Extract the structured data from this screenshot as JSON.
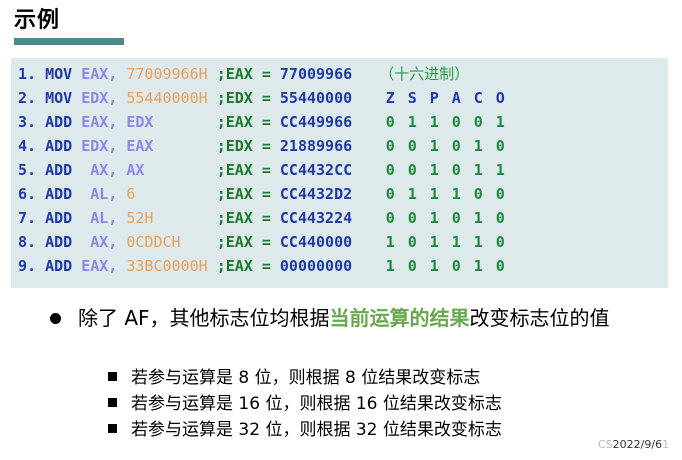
{
  "title": "示例",
  "code_lines": [
    {
      "num": "1.",
      "op": "MOV",
      "a1": "EAX,",
      "a2": "77009966H",
      "cmt": ";EAX = 77009966",
      "extra": "（十六进制）"
    },
    {
      "num": "2.",
      "op": "MOV",
      "a1": "EDX,",
      "a2": "55440000H",
      "cmt": ";EDX = 55440000",
      "flags": [
        "Z",
        "S",
        "P",
        "A",
        "C",
        "O"
      ]
    },
    {
      "num": "3.",
      "op": "ADD",
      "a1": "EAX,",
      "a2": "EDX",
      "cmt": ";EAX = CC449966",
      "flags": [
        "0",
        "1",
        "1",
        "0",
        "0",
        "1"
      ]
    },
    {
      "num": "4.",
      "op": "ADD",
      "a1": "EDX,",
      "a2": "EAX",
      "cmt": ";EDX = 21889966",
      "flags": [
        "0",
        "0",
        "1",
        "0",
        "1",
        "0"
      ]
    },
    {
      "num": "5.",
      "op": "ADD",
      "a1": "AX,",
      "a2": "AX",
      "cmt": ";EAX = CC4432CC",
      "flags": [
        "0",
        "0",
        "1",
        "0",
        "1",
        "1"
      ]
    },
    {
      "num": "6.",
      "op": "ADD",
      "a1": "AL,",
      "a2": "6",
      "cmt": ";EAX = CC4432D2",
      "flags": [
        "0",
        "1",
        "1",
        "1",
        "0",
        "0"
      ]
    },
    {
      "num": "7.",
      "op": "ADD",
      "a1": "AL,",
      "a2": "52H",
      "cmt": ";EAX = CC443224",
      "flags": [
        "0",
        "0",
        "1",
        "0",
        "1",
        "0"
      ]
    },
    {
      "num": "8.",
      "op": "ADD",
      "a1": "AX,",
      "a2": "0CDDCH",
      "cmt": ";EAX = CC440000",
      "flags": [
        "1",
        "0",
        "1",
        "1",
        "1",
        "0"
      ]
    },
    {
      "num": "9.",
      "op": "ADD",
      "a1": "EAX,",
      "a2": "33BC0000H",
      "cmt": ";EAX = 00000000",
      "flags": [
        "1",
        "0",
        "1",
        "0",
        "1",
        "0"
      ]
    }
  ],
  "bullet": {
    "pre": "除了 AF，其他标志位均根据",
    "highlight": "当前运算的结果",
    "post": "改变标志位的值"
  },
  "sub_bullets": [
    "若参与运算是  8 位，则根据  8 位结果改变标志",
    "若参与运算是 16 位，则根据 16 位结果改变标志",
    "若参与运算是 32 位，则根据 32 位结果改变标志"
  ],
  "footer_date": "2022/9/6",
  "watermark_text": "CS",
  "watermark_tail": "1"
}
